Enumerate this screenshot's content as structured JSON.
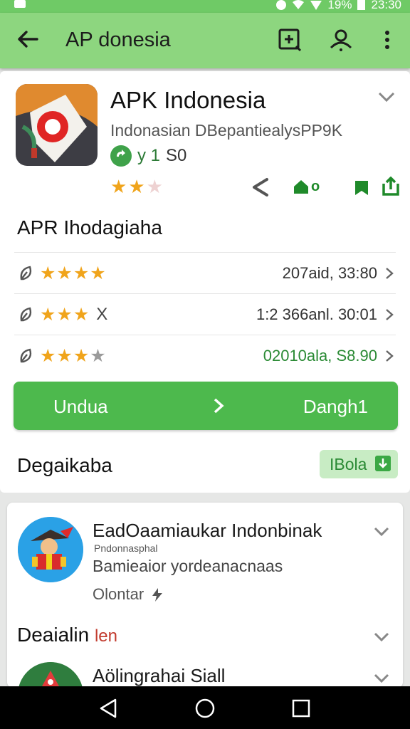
{
  "status_bar": {
    "battery": "19%",
    "time": "23:30"
  },
  "app_bar": {
    "title": "AP donesia",
    "icons": [
      "back-arrow-icon",
      "add-box-icon",
      "account-icon",
      "more-vert-icon"
    ]
  },
  "app": {
    "name": "APK Indonesia",
    "developer": "Indonasian DBepantiealysPP9K",
    "badge_text": "y 1",
    "badge_num": "S0",
    "stars": [
      "on",
      "on",
      "off"
    ],
    "fav_label": "o"
  },
  "ratings": {
    "title": "APR Ihodagiaha",
    "rows": [
      {
        "stars": [
          1,
          1,
          1,
          1
        ],
        "extra": "",
        "value": "207aid, 33:80",
        "green": false
      },
      {
        "stars": [
          1,
          1,
          1
        ],
        "extra": "X",
        "value": "1:2 366anl. 30:01",
        "green": false
      },
      {
        "stars": [
          1,
          1,
          1,
          0
        ],
        "extra": "",
        "value": "02010ala, S8.90",
        "green": true
      }
    ]
  },
  "download_button": {
    "left_label": "Undua",
    "right_label": "Dangh1"
  },
  "footer": {
    "title": "Degaikaba",
    "button_label": "IBola"
  },
  "card2": {
    "title": "EadOaamiaukar Indonbinak",
    "small_text": "Pndonnasphal",
    "subtitle": "Bamieaior yordeanacnaas",
    "status": "Olontar",
    "section_title": "Deaialin",
    "section_tag": "len",
    "next_title": "Aölingrahai Siall"
  },
  "colors": {
    "accent": "#4db94d",
    "app_bar": "#8dd67f",
    "star": "#f0a41b"
  }
}
